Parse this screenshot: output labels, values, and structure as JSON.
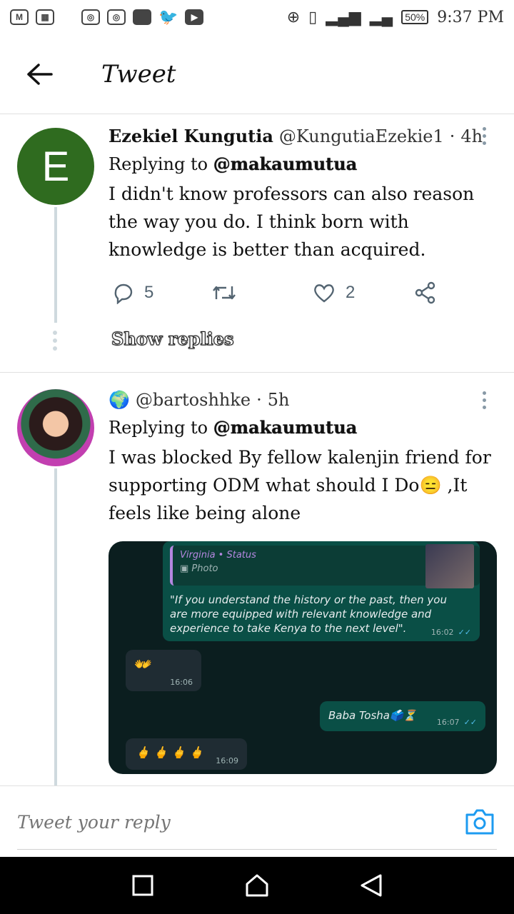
{
  "status_bar": {
    "left_icons": [
      "gmail-icon",
      "gallery-icon",
      "instagram-icon",
      "instagram-icon",
      "app-icon",
      "twitter-icon",
      "youtube-icon"
    ],
    "battery": "50%",
    "time": "9:37 PM"
  },
  "header": {
    "title": "Tweet"
  },
  "tweets": [
    {
      "avatar_letter": "E",
      "name": "Ezekiel Kungutia",
      "handle": "@KungutiaEzekie1",
      "time": "4h",
      "replying_label": "Replying to",
      "replying_to": "@makaumutua",
      "text": "I didn't know professors can also reason the way you do. I think born with knowledge is better than acquired.",
      "reply_count": "5",
      "retweet_count": "",
      "like_count": "2",
      "show_replies": "Show replies"
    },
    {
      "name_emoji": "🌍",
      "handle": "@bartoshhke",
      "time": "5h",
      "replying_label": "Replying to",
      "replying_to": "@makaumutua",
      "text": "I was blocked By fellow kalenjin friend for supporting ODM what should I Do😑 ,It  feels like being alone",
      "image": {
        "quote_title": "Virginia • Status",
        "quote_sub": "Photo",
        "msg1": "\"If you understand the history or the past, then you are more equipped with relevant knowledge and experience to take Kenya to the next level\".",
        "msg1_time": "16:02",
        "msg2": "👐",
        "msg2_time": "16:06",
        "msg3": "Baba Tosha🗳️⏳",
        "msg3_time": "16:07",
        "msg4": "🖕 🖕 🖕 🖕",
        "msg4_time": "16:09"
      }
    }
  ],
  "reply_bar": {
    "placeholder": "Tweet your reply"
  },
  "colors": {
    "accent": "#1d9bf0",
    "avatar_bg": "#2f6b1f",
    "icon_gray": "#536471"
  }
}
